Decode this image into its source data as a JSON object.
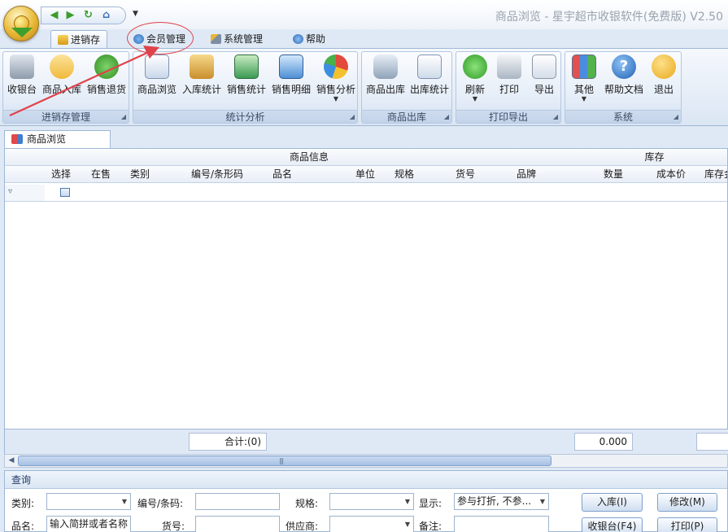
{
  "window": {
    "title": "商品浏览 - 星宇超市收银软件(免费版) V2.50"
  },
  "ribbon_tabs": [
    {
      "label": "进销存",
      "active": true
    },
    {
      "label": "会员管理",
      "active": false
    },
    {
      "label": "系统管理",
      "active": false
    },
    {
      "label": "帮助",
      "active": false
    }
  ],
  "groups": {
    "inventory": {
      "label": "进销存管理",
      "buttons": {
        "cashier": "收银台",
        "stock_in": "商品入库",
        "return": "销售退货"
      }
    },
    "stats": {
      "label": "统计分析",
      "buttons": {
        "browse": "商品浏览",
        "in_stats": "入库统计",
        "sales_stats": "销售统计",
        "sales_detail": "销售明细",
        "sales_analysis": "销售分析"
      }
    },
    "outbound": {
      "label": "商品出库",
      "buttons": {
        "out": "商品出库",
        "out_stats": "出库统计"
      }
    },
    "print": {
      "label": "打印导出",
      "buttons": {
        "refresh": "刷新",
        "print": "打印",
        "export": "导出"
      }
    },
    "system": {
      "label": "系统",
      "buttons": {
        "other": "其他",
        "help": "帮助文档",
        "exit": "退出"
      }
    }
  },
  "document_tab": "商品浏览",
  "grid": {
    "band_product": "商品信息",
    "band_stock": "库存",
    "columns": [
      "选择",
      "在售",
      "类别",
      "编号/条形码",
      "品名",
      "单位",
      "规格",
      "货号",
      "品牌",
      "数量",
      "成本价",
      "库存金"
    ],
    "footer_total": "合计:(0)",
    "footer_qty": "0.000"
  },
  "query": {
    "title": "查询",
    "labels": {
      "category": "类别:",
      "code": "编号/条码:",
      "spec": "规格:",
      "display": "显示:",
      "name": "品名:",
      "item_no": "货号:",
      "supplier": "供应商:",
      "note": "备注:"
    },
    "display_value": "参与打折, 不参...",
    "name_placeholder": "输入简拼或者名称",
    "buttons": {
      "stock_in": "入库(I)",
      "edit": "修改(M)",
      "cashier": "收银台(F4)",
      "print": "打印(P)"
    }
  },
  "colors": {
    "accent": "#9fb7d6",
    "annotation": "#e0424a"
  }
}
